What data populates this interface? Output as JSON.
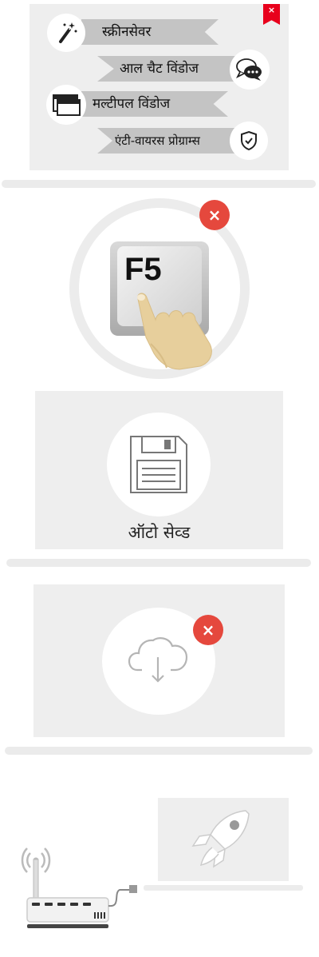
{
  "features": {
    "screensaver_label": "स्क्रीनसेवर",
    "all_chat_windows_label": "आल चैट विंडोज",
    "multiple_windows_label": "मल्टीपल विंडोज",
    "antivirus_label": "एंटी-वायरस प्रोग्राम्स"
  },
  "refresh": {
    "key_label": "F5"
  },
  "autosave": {
    "label": "ऑटो सेव्ड"
  },
  "close_symbol": "×",
  "colors": {
    "accent_red": "#e5483d",
    "flag_red": "#e8001c",
    "panel_gray": "#eeeeee"
  }
}
